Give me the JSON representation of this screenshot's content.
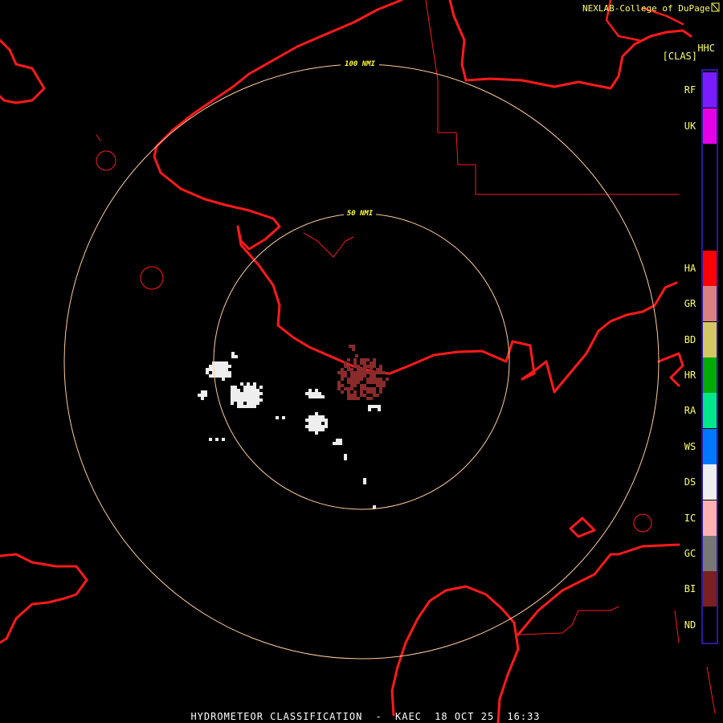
{
  "header": {
    "credit": "NEXLAB-College of DuPage",
    "credit_icon": "diagonal-arrow-icon",
    "product_code": "HHC",
    "units": "[CLAS]"
  },
  "range_rings": [
    {
      "label": "50 NMI"
    },
    {
      "label": "100 NMI"
    }
  ],
  "legend": {
    "border_color": "#3b1fd6",
    "items": [
      {
        "code": "RF",
        "color": "#7a1cff"
      },
      {
        "code": "UK",
        "color": "#e600e6"
      },
      {
        "code": "HA",
        "color": "#ff0000"
      },
      {
        "code": "GR",
        "color": "#d98080"
      },
      {
        "code": "BD",
        "color": "#d4c864"
      },
      {
        "code": "HR",
        "color": "#00aa00"
      },
      {
        "code": "RA",
        "color": "#00e68a"
      },
      {
        "code": "WS",
        "color": "#0077ff"
      },
      {
        "code": "DS",
        "color": "#eeeeee"
      },
      {
        "code": "IC",
        "color": "#ffb0b0"
      },
      {
        "code": "GC",
        "color": "#777777"
      },
      {
        "code": "BI",
        "color": "#7a2020"
      },
      {
        "code": "ND",
        "color": "#000000"
      }
    ]
  },
  "map_colors": {
    "coastline": "#ff1a1a",
    "range_ring": "#ffcc99",
    "dry_snow_echo": "#eeeeee",
    "biological_echo": "#8a2a2a"
  },
  "footer": {
    "product": "HYDROMETEOR CLASSIFICATION",
    "separator": "-",
    "station": "KAEC",
    "date": "18 OCT 25",
    "time": "16:33"
  }
}
